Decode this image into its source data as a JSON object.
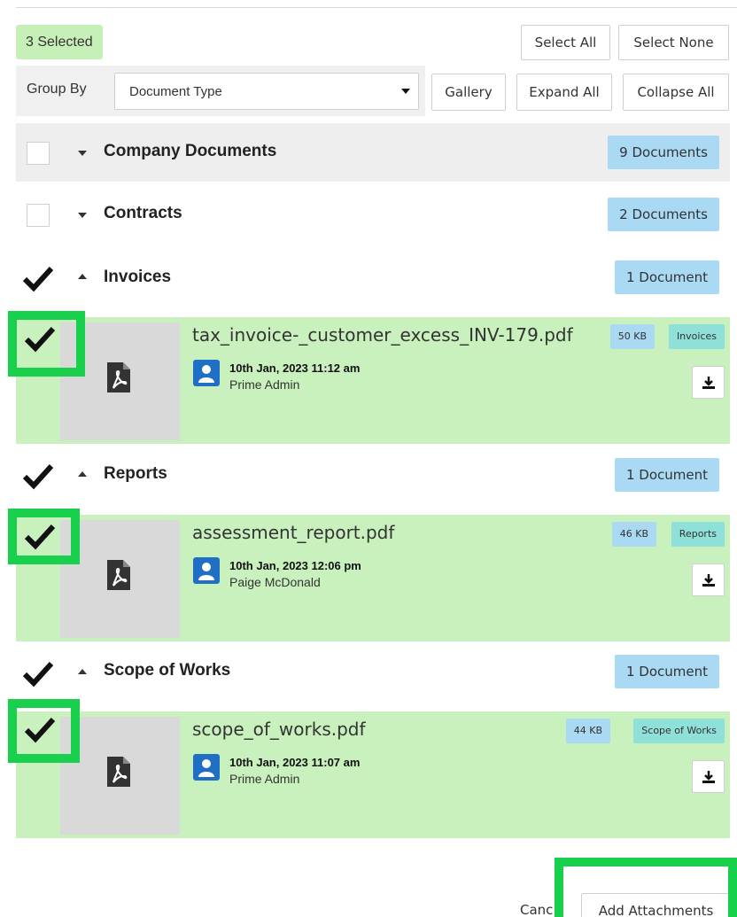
{
  "toolbar": {
    "selected_label": "3 Selected",
    "select_all": "Select All",
    "select_none": "Select None",
    "group_by_label": "Group By",
    "group_by_value": "Document Type",
    "gallery": "Gallery",
    "expand_all": "Expand All",
    "collapse_all": "Collapse All"
  },
  "groups": [
    {
      "title": "Company Documents",
      "count": "9 Documents",
      "checked": false,
      "expanded": false
    },
    {
      "title": "Contracts",
      "count": "2 Documents",
      "checked": false,
      "expanded": false
    },
    {
      "title": "Invoices",
      "count": "1 Document",
      "checked": true,
      "expanded": true
    },
    {
      "title": "Reports",
      "count": "1 Document",
      "checked": true,
      "expanded": true
    },
    {
      "title": "Scope of Works",
      "count": "1 Document",
      "checked": true,
      "expanded": true
    }
  ],
  "documents": [
    {
      "name": "tax_invoice-_customer_excess_INV-179.pdf",
      "size": "50 KB",
      "type": "Invoices",
      "date": "10th Jan, 2023 11:12 am",
      "user": "Prime Admin",
      "checked": true
    },
    {
      "name": "assessment_report.pdf",
      "size": "46 KB",
      "type": "Reports",
      "date": "10th Jan, 2023 12:06 pm",
      "user": "Paige McDonald",
      "checked": true
    },
    {
      "name": "scope_of_works.pdf",
      "size": "44 KB",
      "type": "Scope of Works",
      "date": "10th Jan, 2023 11:07 am",
      "user": "Prime Admin",
      "checked": true
    }
  ],
  "footer": {
    "cancel": "Canc",
    "add_attachments": "Add Attachments"
  },
  "colors": {
    "selected_green": "#c9f1bd",
    "highlight_green": "#18d04c",
    "count_badge_blue": "#a9d9f3",
    "type_badge_teal": "#8fe0d9",
    "avatar_blue": "#1f6fc5"
  },
  "icons": [
    "chevron-down-icon",
    "chevron-up-icon",
    "checkmark-icon",
    "pdf-icon",
    "user-avatar-icon",
    "download-icon"
  ]
}
